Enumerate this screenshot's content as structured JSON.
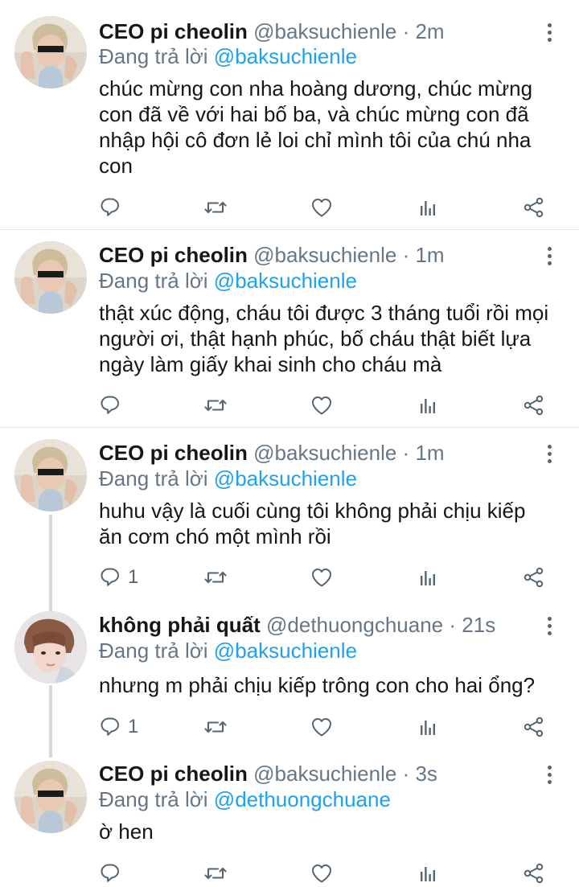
{
  "tweets": [
    {
      "name": "CEO pi cheolin",
      "handle": "@baksuchienle",
      "time": "2m",
      "reply_prefix": "Đang trả lời",
      "reply_to": "@baksuchienle",
      "text": "chúc mừng con nha hoàng dương, chúc mừng con đã về với hai bố ba, và chúc mừng con đã nhập hội cô đơn lẻ loi chỉ mình tôi của chú nha con",
      "reply_count": ""
    },
    {
      "name": "CEO pi cheolin",
      "handle": "@baksuchienle",
      "time": "1m",
      "reply_prefix": "Đang trả lời",
      "reply_to": "@baksuchienle",
      "text": "thật xúc động, cháu tôi được 3 tháng tuổi rồi mọi người ơi, thật hạnh phúc, bố cháu thật biết lựa ngày làm giấy khai sinh cho cháu mà",
      "reply_count": ""
    },
    {
      "name": "CEO pi cheolin",
      "handle": "@baksuchienle",
      "time": "1m",
      "reply_prefix": "Đang trả lời",
      "reply_to": "@baksuchienle",
      "text": "huhu vậy là cuối cùng tôi không phải chịu kiếp ăn cơm chó một mình rồi",
      "reply_count": "1"
    },
    {
      "name": "không phải quất",
      "handle": "@dethuongchuane",
      "time": "21s",
      "reply_prefix": "Đang trả lời",
      "reply_to": "@baksuchienle",
      "text": "nhưng m phải chịu kiếp trông con cho hai ổng?",
      "reply_count": "1"
    },
    {
      "name": "CEO pi cheolin",
      "handle": "@baksuchienle",
      "time": "3s",
      "reply_prefix": "Đang trả lời",
      "reply_to": "@dethuongchuane",
      "text": "ờ hen",
      "reply_count": ""
    }
  ],
  "separator": "·",
  "icons": {
    "reply": "reply-icon",
    "retweet": "retweet-icon",
    "like": "heart-icon",
    "analytics": "analytics-icon",
    "share": "share-icon",
    "more": "more-options-icon"
  },
  "colors": {
    "link": "#1da1f2",
    "secondary_text": "#657786",
    "icon": "#546571"
  }
}
